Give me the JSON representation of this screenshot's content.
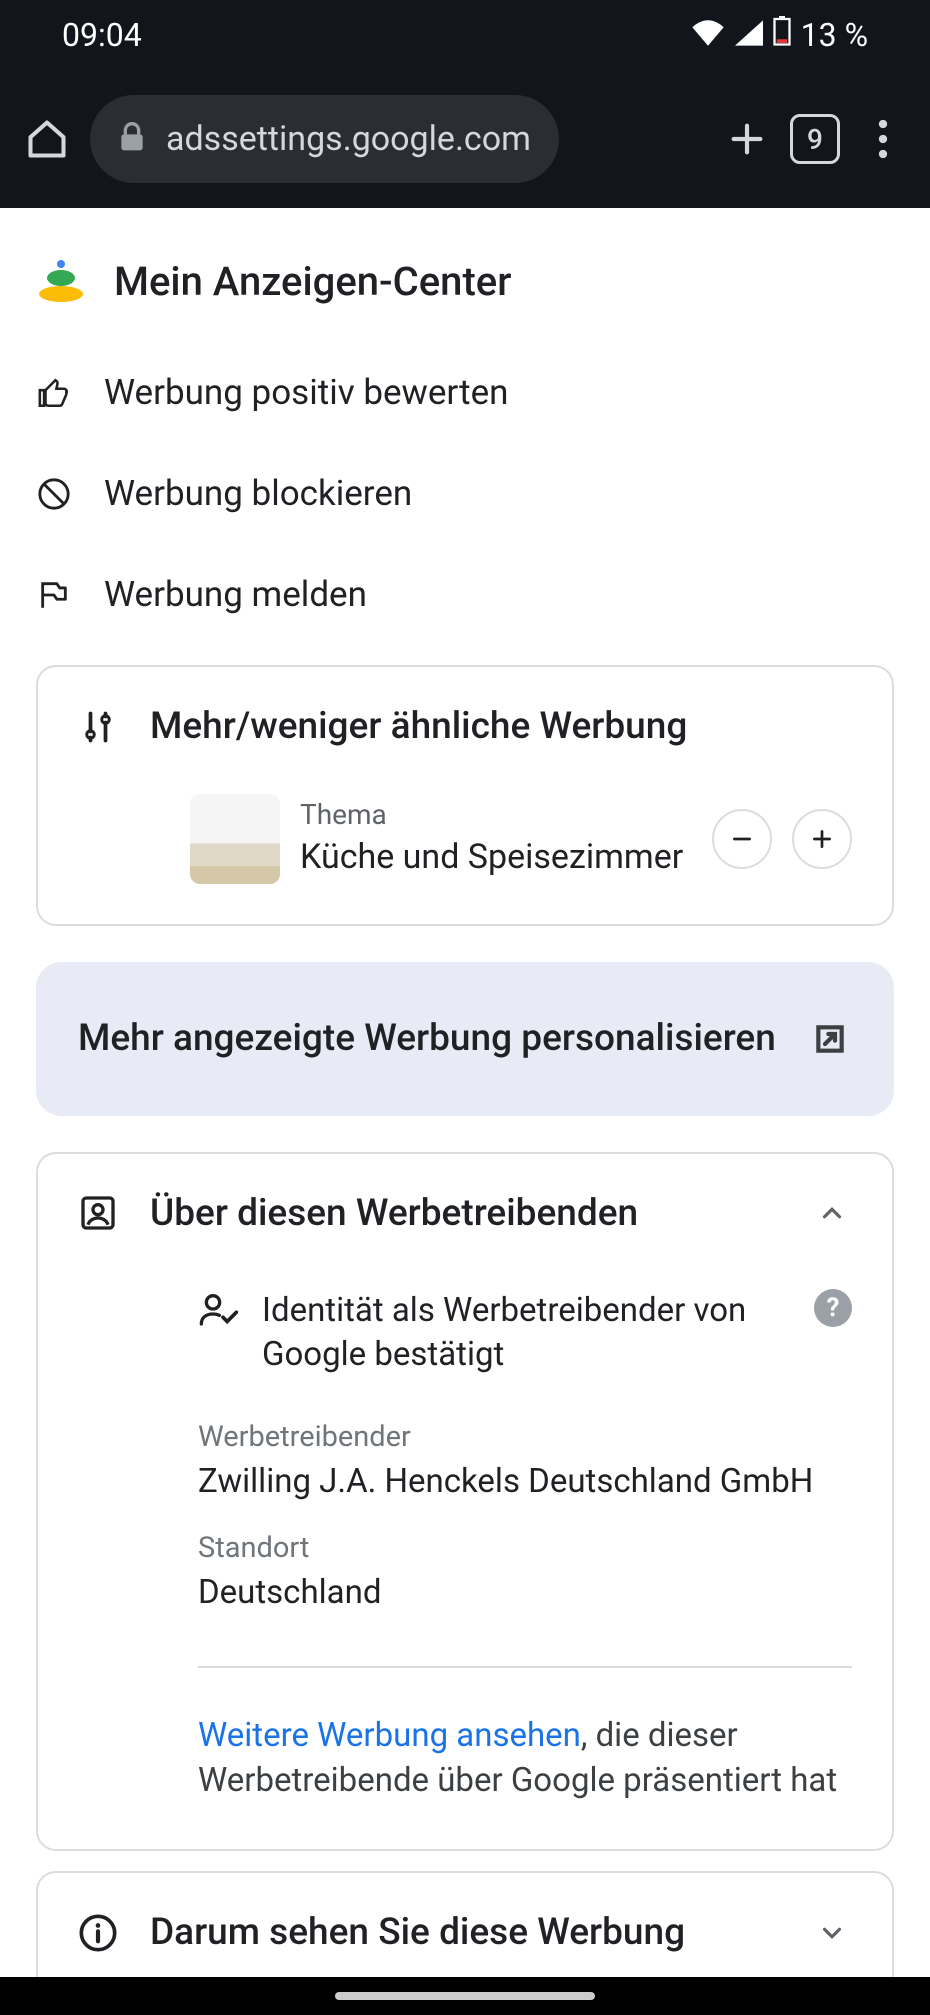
{
  "status": {
    "time": "09:04",
    "battery_pct": "13 %"
  },
  "browser": {
    "url": "adssettings.google.com",
    "tab_count": "9"
  },
  "header": {
    "title": "Mein Anzeigen-Center"
  },
  "actions": {
    "like": "Werbung positiv bewerten",
    "block": "Werbung blockieren",
    "report": "Werbung melden"
  },
  "similar_card": {
    "title": "Mehr/weniger ähnliche Werbung",
    "topic_label": "Thema",
    "topic_value": "Küche und Speisezimmer"
  },
  "personalize_card": {
    "text": "Mehr angezeigte Werbung personalisieren"
  },
  "advertiser_card": {
    "title": "Über diesen Werbetreibenden",
    "identity_text": "Identität als Werbetreibender von Google bestätigt",
    "advertiser_label": "Werbetreibender",
    "advertiser_value": "Zwilling J.A. Henckels Deutschland GmbH",
    "location_label": "Standort",
    "location_value": "Deutschland",
    "more_link": "Weitere Werbung ansehen",
    "more_text": ", die dieser Werbetreibende über Google präsentiert hat"
  },
  "why_card": {
    "title": "Darum sehen Sie diese Werbung"
  }
}
